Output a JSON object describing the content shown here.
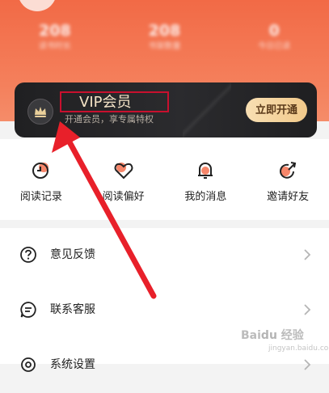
{
  "vip": {
    "title": "VIP会员",
    "subtitle": "开通会员，享专属特权",
    "open_button": "立即开通"
  },
  "quick_actions": [
    {
      "label": "阅读记录",
      "icon": "clock-icon"
    },
    {
      "label": "阅读偏好",
      "icon": "heart-icon"
    },
    {
      "label": "我的消息",
      "icon": "bell-icon"
    },
    {
      "label": "邀请好友",
      "icon": "share-icon"
    }
  ],
  "menu": [
    {
      "label": "意见反馈",
      "icon": "help-circle-icon"
    },
    {
      "label": "联系客服",
      "icon": "chat-icon"
    },
    {
      "label": "系统设置",
      "icon": "gear-icon"
    }
  ],
  "colors": {
    "header": "#f26a46",
    "vip_card": "#222224",
    "vip_gold": "#f3e2c6",
    "annotation_red": "#e8202a"
  }
}
